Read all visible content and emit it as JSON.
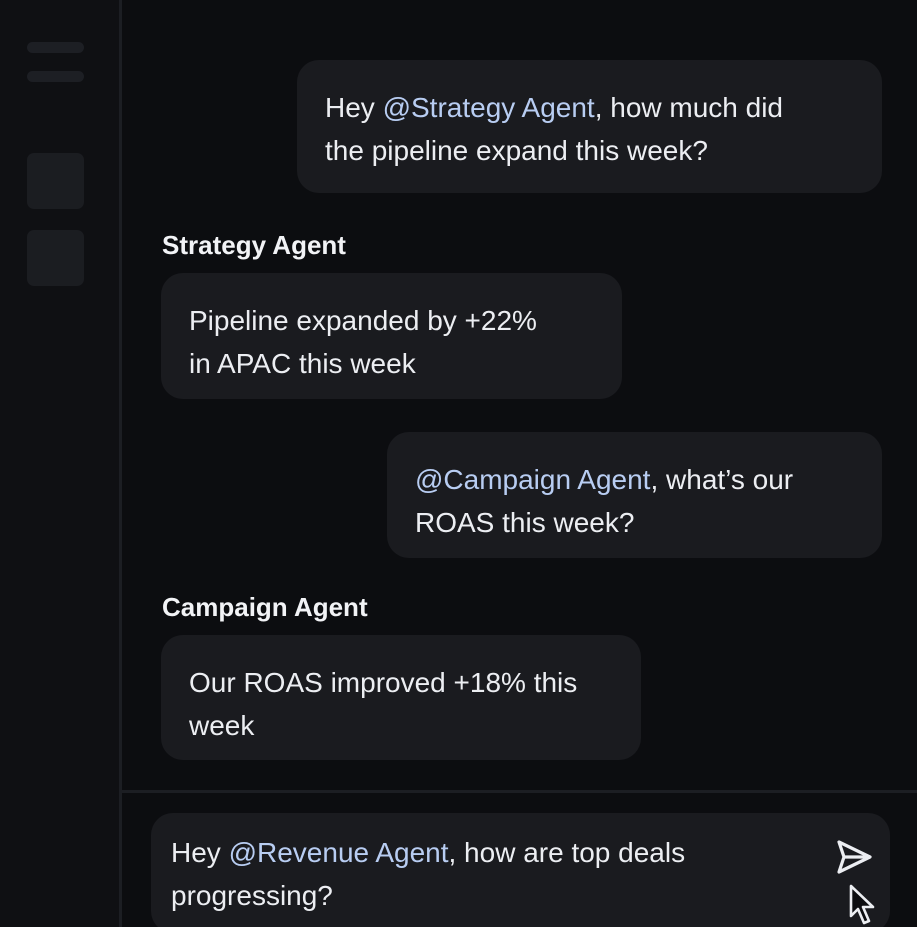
{
  "messages": [
    {
      "role": "user",
      "prefix": "Hey ",
      "mention": "@Strategy Agent",
      "text": ", how much did\nthe pipeline expand this week?"
    },
    {
      "role": "agent",
      "sender": "Strategy Agent",
      "text": "Pipeline expanded by +22%\nin APAC this week"
    },
    {
      "role": "user",
      "prefix": "",
      "mention": "@Campaign Agent",
      "text": ", what’s our\nROAS this week?"
    },
    {
      "role": "agent",
      "sender": "Campaign Agent",
      "text": "Our ROAS improved +18% this\nweek"
    }
  ],
  "composer": {
    "prefix": "Hey ",
    "mention": "@Revenue Agent",
    "text": ", how are top deals\nprogressing?"
  },
  "icons": {
    "send": "send-icon",
    "cursor": "mouse-pointer-icon",
    "menu": "hamburger-menu-icon"
  },
  "colors": {
    "background": "#0c0d10",
    "bubble": "#1a1b1f",
    "mention": "#b8cdf2",
    "text": "#eceef2"
  }
}
